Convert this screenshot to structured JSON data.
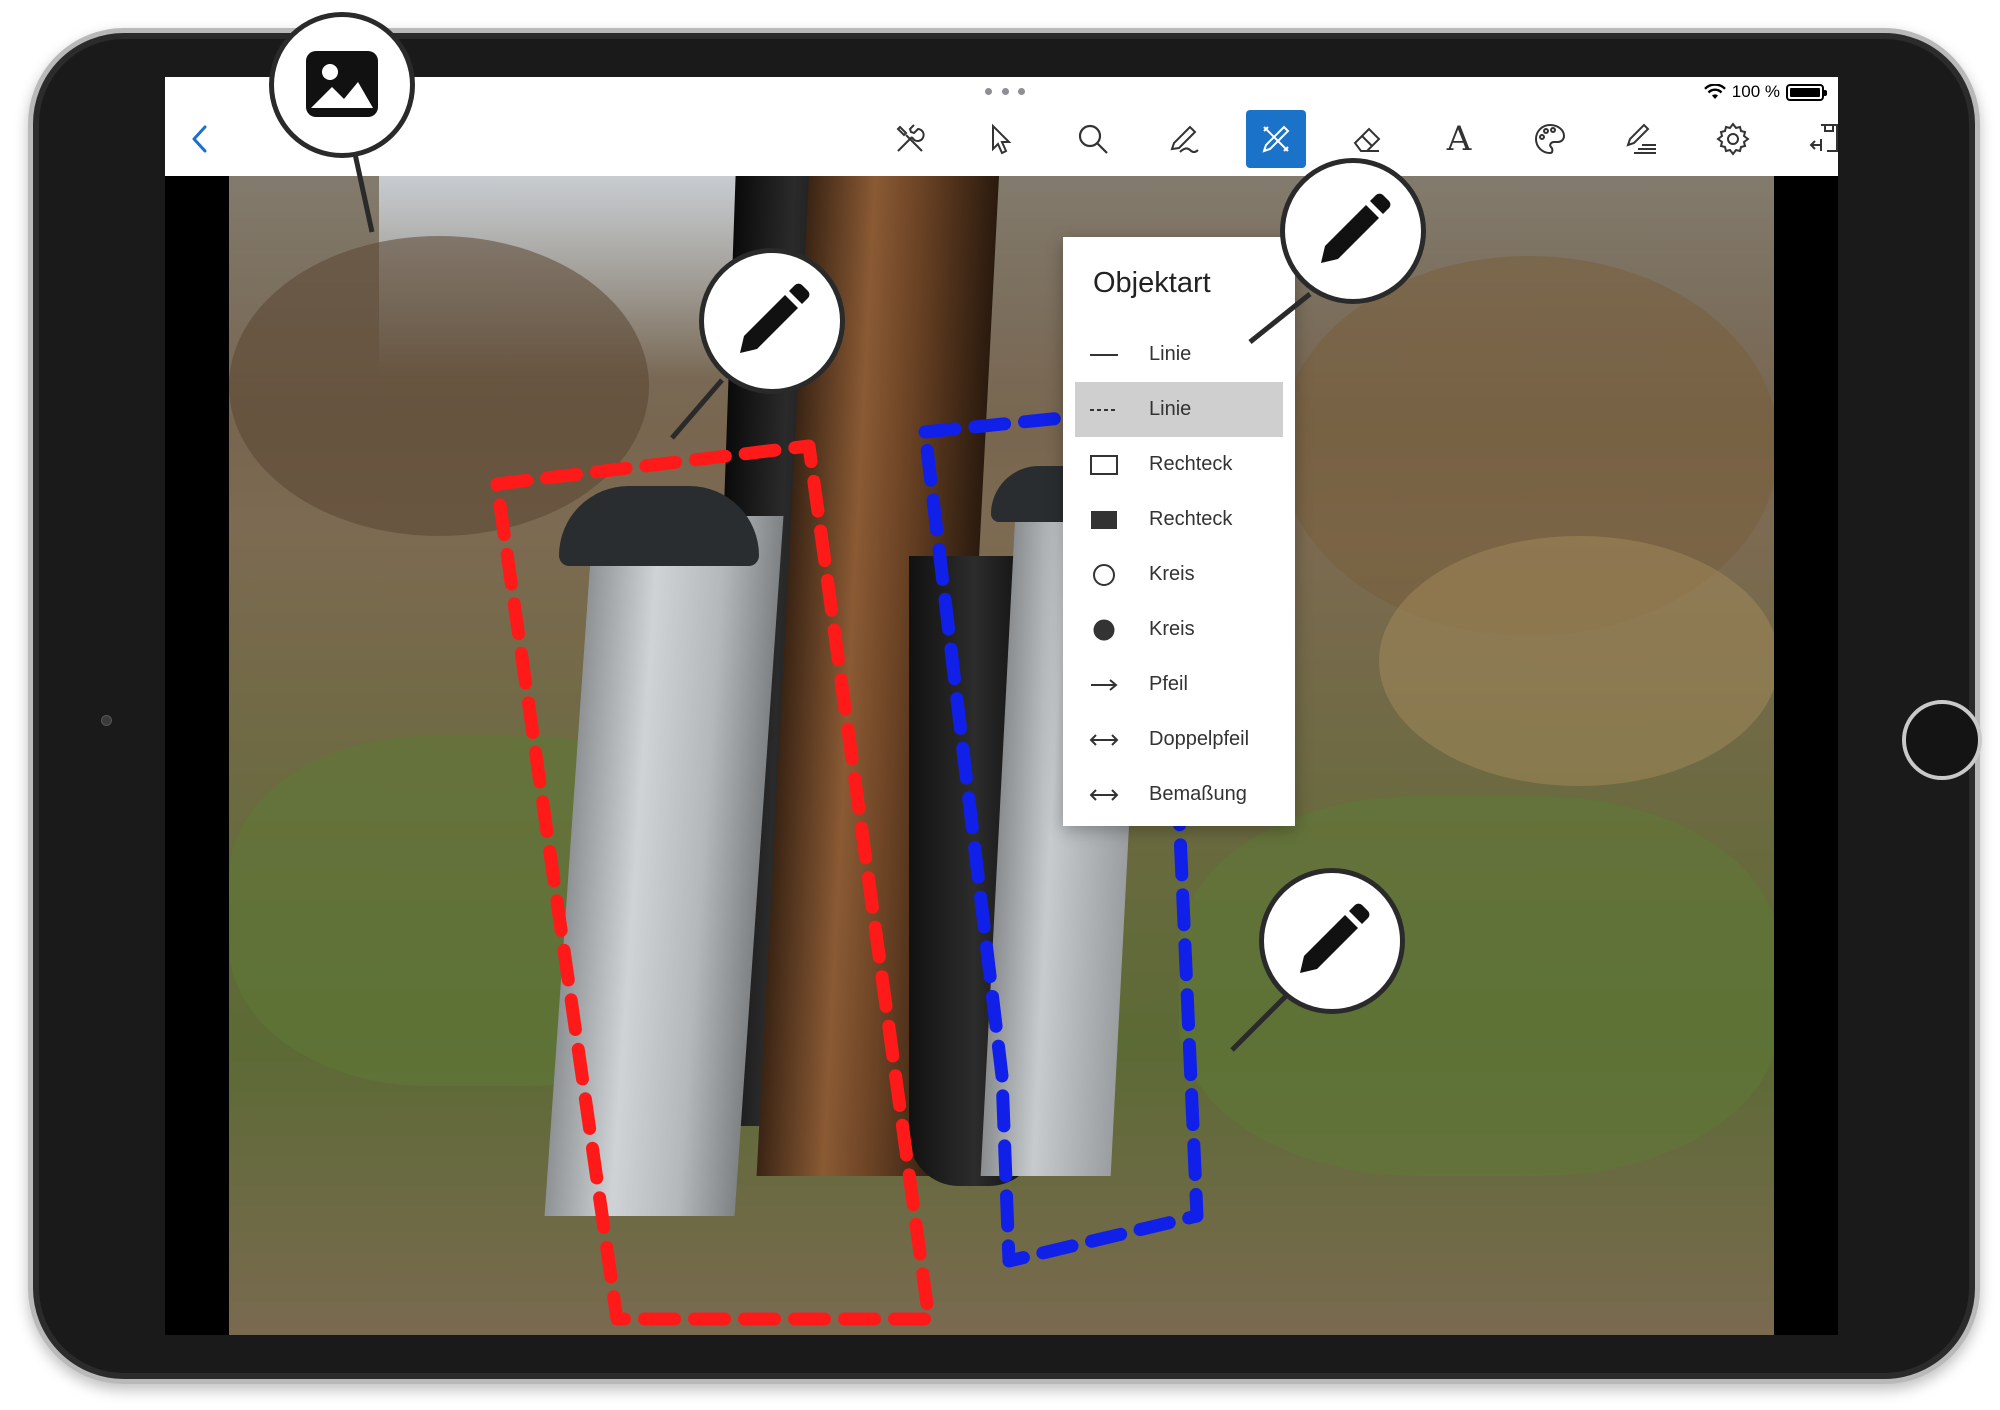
{
  "status": {
    "battery_text": "100 %",
    "battery_level": 1.0
  },
  "toolbar": {
    "back_label": "‹",
    "text_tool_glyph": "A",
    "tools": [
      {
        "name": "tools-icon"
      },
      {
        "name": "pointer-icon"
      },
      {
        "name": "search-icon"
      },
      {
        "name": "pen-icon"
      },
      {
        "name": "draw-shapes-icon",
        "active": true
      },
      {
        "name": "eraser-icon"
      },
      {
        "name": "text-icon"
      },
      {
        "name": "palette-icon"
      },
      {
        "name": "edit-lines-icon"
      },
      {
        "name": "gear-icon"
      },
      {
        "name": "export-icon"
      }
    ],
    "active_color": "#1a73c9"
  },
  "popover": {
    "title": "Objektart",
    "items": [
      {
        "label": "Linie",
        "glyph": "line-solid"
      },
      {
        "label": "Linie",
        "glyph": "line-dashed",
        "selected": true
      },
      {
        "label": "Rechteck",
        "glyph": "rect-outline"
      },
      {
        "label": "Rechteck",
        "glyph": "rect-filled"
      },
      {
        "label": "Kreis",
        "glyph": "circle-outline"
      },
      {
        "label": "Kreis",
        "glyph": "circle-filled"
      },
      {
        "label": "Pfeil",
        "glyph": "arrow"
      },
      {
        "label": "Doppelpfeil",
        "glyph": "double-arrow"
      },
      {
        "label": "Bemaßung",
        "glyph": "dimension"
      }
    ]
  },
  "annotation_colors": {
    "red": "#ff1a1a",
    "blue": "#1020e8"
  },
  "callouts": [
    {
      "icon": "image-icon"
    },
    {
      "icon": "pencil-icon"
    },
    {
      "icon": "pencil-icon"
    },
    {
      "icon": "pencil-icon"
    }
  ]
}
